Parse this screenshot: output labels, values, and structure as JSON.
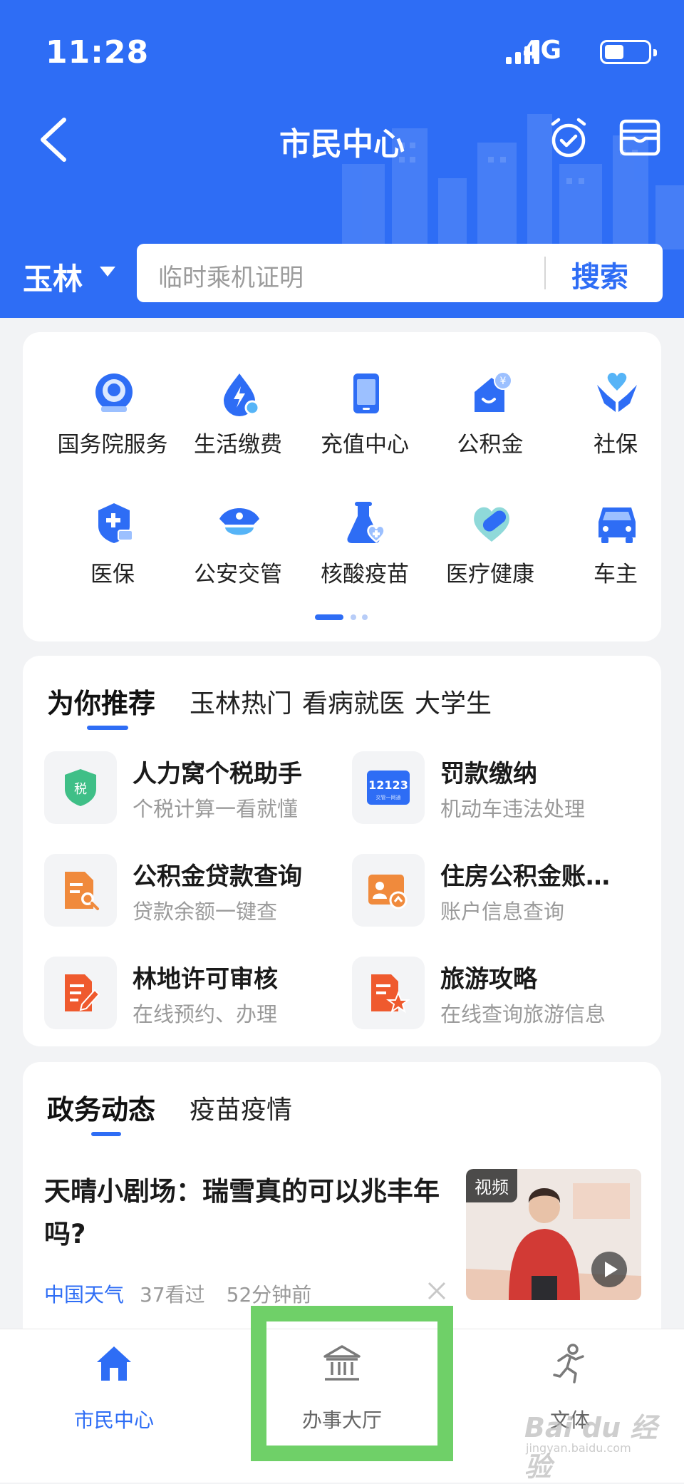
{
  "status": {
    "time": "11:28",
    "network": "4G"
  },
  "nav": {
    "title": "市民中心",
    "back_icon": "chevron-left-icon",
    "alarm_icon": "alarm-clock-icon",
    "wallet_icon": "wallet-card-icon"
  },
  "city": {
    "name": "玉林"
  },
  "search": {
    "placeholder": "临时乘机证明",
    "button": "搜索"
  },
  "services": [
    {
      "label": "国务院服务",
      "icon": "state-council-emblem-icon"
    },
    {
      "label": "生活缴费",
      "icon": "utility-drop-icon"
    },
    {
      "label": "充值中心",
      "icon": "phone-recharge-icon"
    },
    {
      "label": "公积金",
      "icon": "housing-fund-icon"
    },
    {
      "label": "社保",
      "icon": "social-security-heart-hands-icon"
    },
    {
      "label": "医保",
      "icon": "medical-insurance-shield-icon"
    },
    {
      "label": "公安交管",
      "icon": "police-cap-icon"
    },
    {
      "label": "核酸疫苗",
      "icon": "flask-heart-icon"
    },
    {
      "label": "医疗健康",
      "icon": "health-capsule-icon"
    },
    {
      "label": "车主",
      "icon": "car-icon"
    }
  ],
  "recommend": {
    "tabs": [
      "为你推荐",
      "玉林热门",
      "看病就医",
      "大学生"
    ],
    "active_tab": "为你推荐",
    "items": [
      {
        "title": "人力窝个税助手",
        "subtitle": "个税计算一看就懂",
        "icon": "tax-badge-icon"
      },
      {
        "title": "罚款缴纳",
        "subtitle": "机动车违法处理",
        "icon": "12123-logo-icon",
        "logo_text": "12123",
        "logo_sub": "交管一网通"
      },
      {
        "title": "公积金贷款查询",
        "subtitle": "贷款余额一键查",
        "icon": "document-search-icon"
      },
      {
        "title": "住房公积金账…",
        "subtitle": "账户信息查询",
        "icon": "account-card-icon"
      },
      {
        "title": "林地许可审核",
        "subtitle": "在线预约、办理",
        "icon": "document-edit-icon"
      },
      {
        "title": "旅游攻略",
        "subtitle": "在线查询旅游信息",
        "icon": "document-star-icon"
      }
    ]
  },
  "news": {
    "tabs": [
      "政务动态",
      "疫苗疫情"
    ],
    "active_tab": "政务动态",
    "item": {
      "title": "天晴小剧场：瑞雪真的可以兆丰年吗?",
      "source": "中国天气",
      "views": "37看过",
      "time": "52分钟前",
      "thumb_tag": "视频"
    }
  },
  "tabbar": [
    {
      "label": "市民中心",
      "icon": "home-icon",
      "active": true
    },
    {
      "label": "办事大厅",
      "icon": "government-hall-icon",
      "active": false
    },
    {
      "label": "文体",
      "icon": "running-person-icon",
      "active": false
    }
  ],
  "watermark": {
    "text": "Bai du 经验",
    "sub": "jingyan.baidu.com"
  },
  "colors": {
    "primary": "#2e6df5",
    "highlight": "#6fd068",
    "orange": "#f08a3c",
    "red_orange": "#ef5a2e",
    "green": "#3fbf87"
  }
}
